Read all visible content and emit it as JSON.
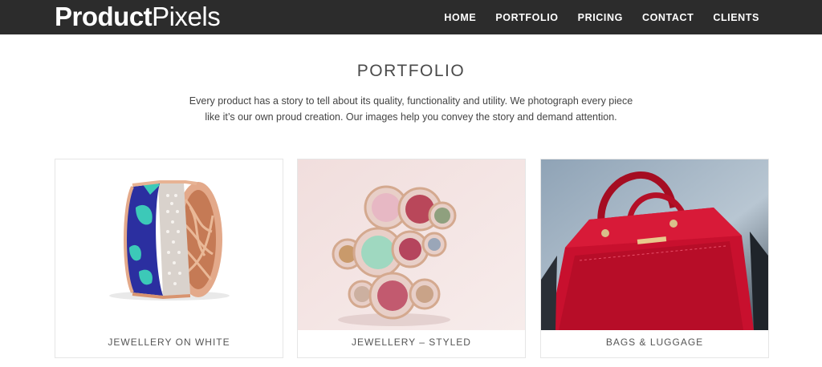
{
  "brand": {
    "name_part1": "Product",
    "name_part2": "Pixels",
    "logo_accent_colors": [
      "#e53935",
      "#43a047",
      "#1e88e5",
      "#fdd835"
    ]
  },
  "nav": {
    "items": [
      {
        "label": "HOME"
      },
      {
        "label": "PORTFOLIO"
      },
      {
        "label": "PRICING"
      },
      {
        "label": "CONTACT"
      },
      {
        "label": "CLIENTS"
      }
    ]
  },
  "portfolio": {
    "title": "PORTFOLIO",
    "intro": "Every product has a story to tell about its quality, functionality and utility. We photograph every piece like it’s our own proud creation. Our images help you convey the story and demand attention.",
    "cards": [
      {
        "caption": "JEWELLERY ON WHITE",
        "image": "enamel-diamond-ring"
      },
      {
        "caption": "JEWELLERY – STYLED",
        "image": "gemstone-rings-stack"
      },
      {
        "caption": "BAGS & LUGGAGE",
        "image": "red-leather-handbag"
      }
    ]
  },
  "colors": {
    "navbar_bg": "#2c2c2c",
    "nav_text": "#ffffff",
    "bag_red": "#c8102e"
  }
}
